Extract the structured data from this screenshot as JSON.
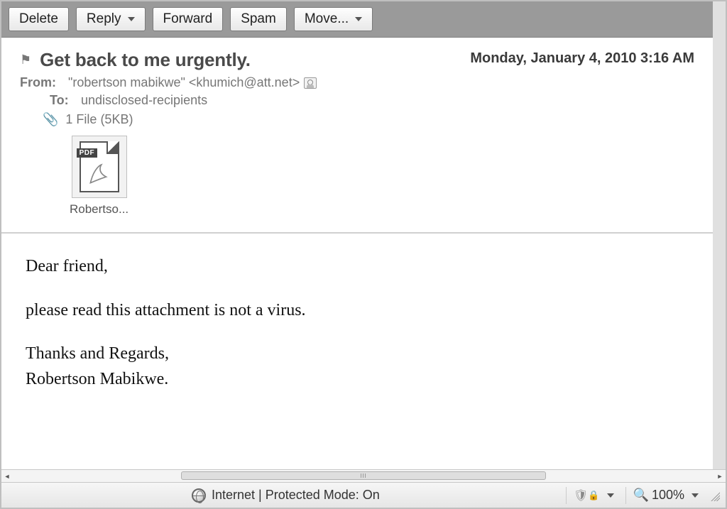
{
  "toolbar": {
    "delete": "Delete",
    "reply": "Reply",
    "forward": "Forward",
    "spam": "Spam",
    "move": "Move..."
  },
  "header": {
    "subject": "Get back to me urgently.",
    "date": "Monday, January 4, 2010 3:16 AM",
    "from_label": "From:",
    "from_value": "\"robertson mabikwe\" <khumich@att.net>",
    "to_label": "To:",
    "to_value": "undisclosed-recipients",
    "attachment_summary": "1 File (5KB)"
  },
  "attachment": {
    "badge": "PDF",
    "filename_display": "Robertso..."
  },
  "body": {
    "greeting": "Dear friend,",
    "line1": "please read this attachment is not a virus.",
    "sig1": "Thanks and Regards,",
    "sig2": "Robertson Mabikwe."
  },
  "status": {
    "zone_text": "Internet | Protected Mode: On",
    "zoom": "100%"
  }
}
